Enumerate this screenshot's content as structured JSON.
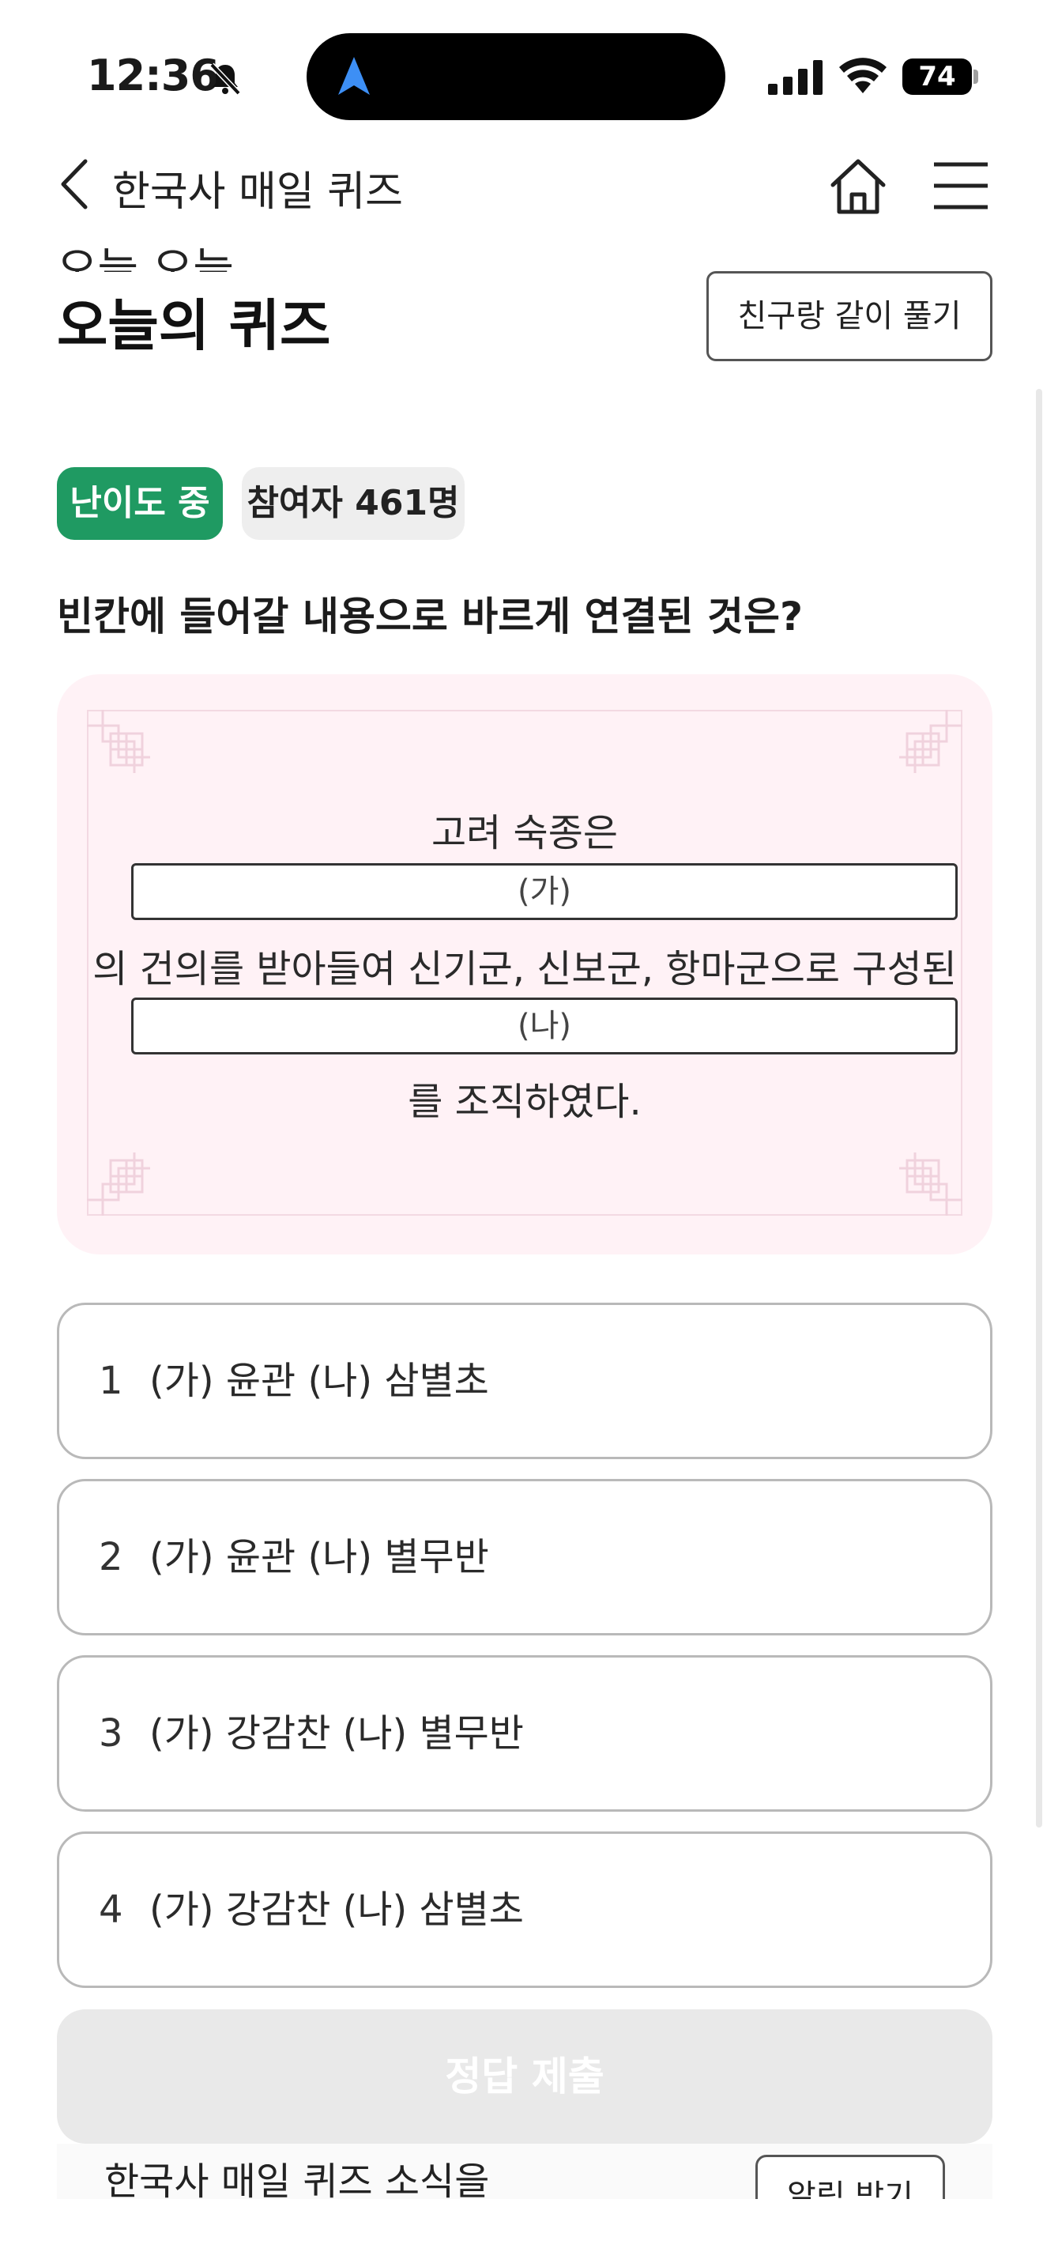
{
  "status_bar": {
    "time": "12:36",
    "battery": "74"
  },
  "header": {
    "title": "한국사 매일 퀴즈"
  },
  "title_area": {
    "partial_heading": "오늘 오늘",
    "title": "오늘의 퀴즈",
    "friend_button": "친구랑 같이 풀기"
  },
  "badges": {
    "difficulty": "난이도 중",
    "participants": "참여자 461명"
  },
  "question": "빈칸에 들어갈 내용으로 바르게 연결된 것은?",
  "passage": {
    "line1": "고려 숙종은",
    "blank_a": "(가)",
    "line2": "의 건의를 받아들여 신기군, 신보군, 항마군으로 구성된",
    "blank_b": "(나)",
    "line3": "를 조직하였다."
  },
  "options": [
    {
      "number": "1",
      "text": "(가) 윤관 (나) 삼별초"
    },
    {
      "number": "2",
      "text": "(가) 윤관 (나) 별무반"
    },
    {
      "number": "3",
      "text": "(가) 강감찬 (나) 별무반"
    },
    {
      "number": "4",
      "text": "(가) 강감찬 (나) 삼별초"
    }
  ],
  "submit_button": "정답 제출",
  "banner": {
    "text": "한국사 매일 퀴즈 소식을",
    "button": "알림 받기"
  },
  "colors": {
    "accent_green": "#1f9a62",
    "passage_bg": "#fff2f6",
    "submit_disabled": "#e9e9e9"
  },
  "icons": [
    "bell-slash-icon",
    "navigation-arrow-icon",
    "signal-icon",
    "wifi-icon",
    "battery-icon",
    "back-chevron-icon",
    "home-icon",
    "menu-icon"
  ]
}
